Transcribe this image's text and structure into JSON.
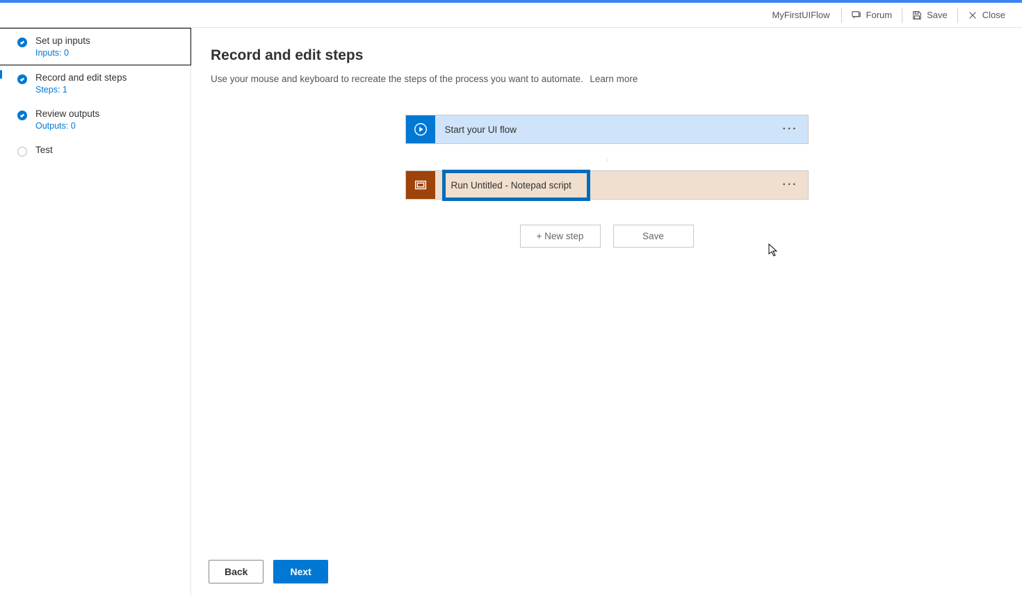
{
  "header": {
    "flowName": "MyFirstUIFlow",
    "forum": "Forum",
    "save": "Save",
    "close": "Close"
  },
  "sidebar": {
    "items": [
      {
        "title": "Set up inputs",
        "sub": "Inputs: 0"
      },
      {
        "title": "Record and edit steps",
        "sub": "Steps: 1"
      },
      {
        "title": "Review outputs",
        "sub": "Outputs: 0"
      },
      {
        "title": "Test"
      }
    ]
  },
  "page": {
    "heading": "Record and edit steps",
    "desc": "Use your mouse and keyboard to recreate the steps of the process you want to automate.",
    "learnMore": "Learn more"
  },
  "flow": {
    "start": "Start your UI flow",
    "script": "Run Untitled - Notepad script",
    "newStep": "+ New step",
    "saveStep": "Save"
  },
  "footer": {
    "back": "Back",
    "next": "Next"
  }
}
